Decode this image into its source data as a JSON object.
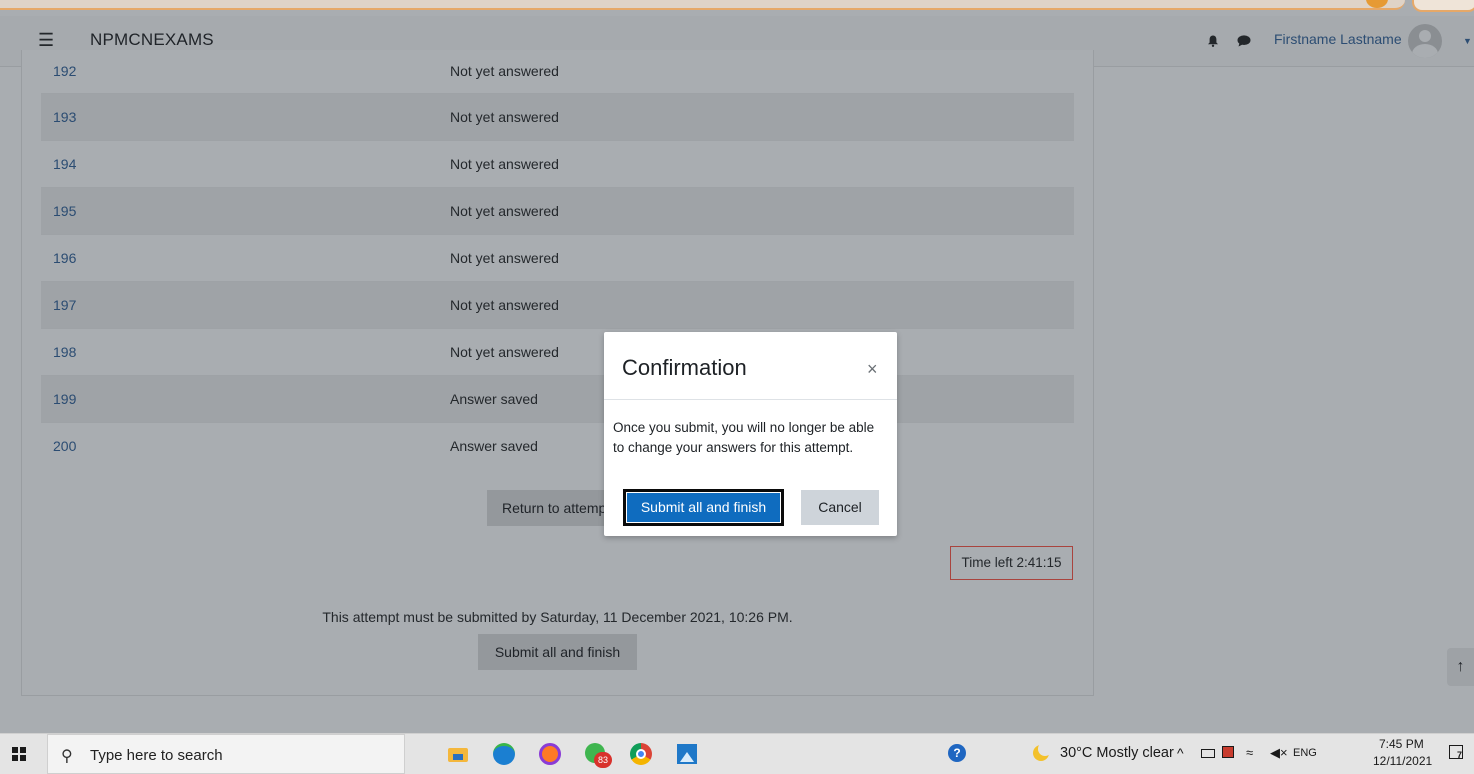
{
  "navbar": {
    "menu_icon": "hamburger-icon",
    "site_name": "NPMCNEXAMS",
    "user_name": "Firstname Lastname"
  },
  "summary": {
    "rows": [
      {
        "number": "192",
        "status": "Not yet answered"
      },
      {
        "number": "193",
        "status": "Not yet answered"
      },
      {
        "number": "194",
        "status": "Not yet answered"
      },
      {
        "number": "195",
        "status": "Not yet answered"
      },
      {
        "number": "196",
        "status": "Not yet answered"
      },
      {
        "number": "197",
        "status": "Not yet answered"
      },
      {
        "number": "198",
        "status": "Not yet answered"
      },
      {
        "number": "199",
        "status": "Answer saved"
      },
      {
        "number": "200",
        "status": "Answer saved"
      }
    ],
    "return_button": "Return to attempt",
    "timer": "Time left 2:41:15",
    "deadline": "This attempt must be submitted by Saturday, 11 December 2021, 10:26 PM.",
    "submit_button": "Submit all and finish"
  },
  "modal": {
    "title": "Confirmation",
    "close_glyph": "×",
    "body": "Once you submit, you will no longer be able to change your answers for this attempt.",
    "submit_button": "Submit all and finish",
    "cancel_button": "Cancel"
  },
  "taskbar": {
    "search_placeholder": "Type here to search",
    "whatsapp_badge": "83",
    "weather": "30°C  Mostly clear",
    "language": "ENG",
    "time": "7:45 PM",
    "date": "12/11/2021",
    "notification_count": "7"
  },
  "colors": {
    "overlay": "#a9adb1",
    "primary_button": "#0f6cbf",
    "link": "#2b4c72",
    "timer_border": "#a9443e"
  }
}
